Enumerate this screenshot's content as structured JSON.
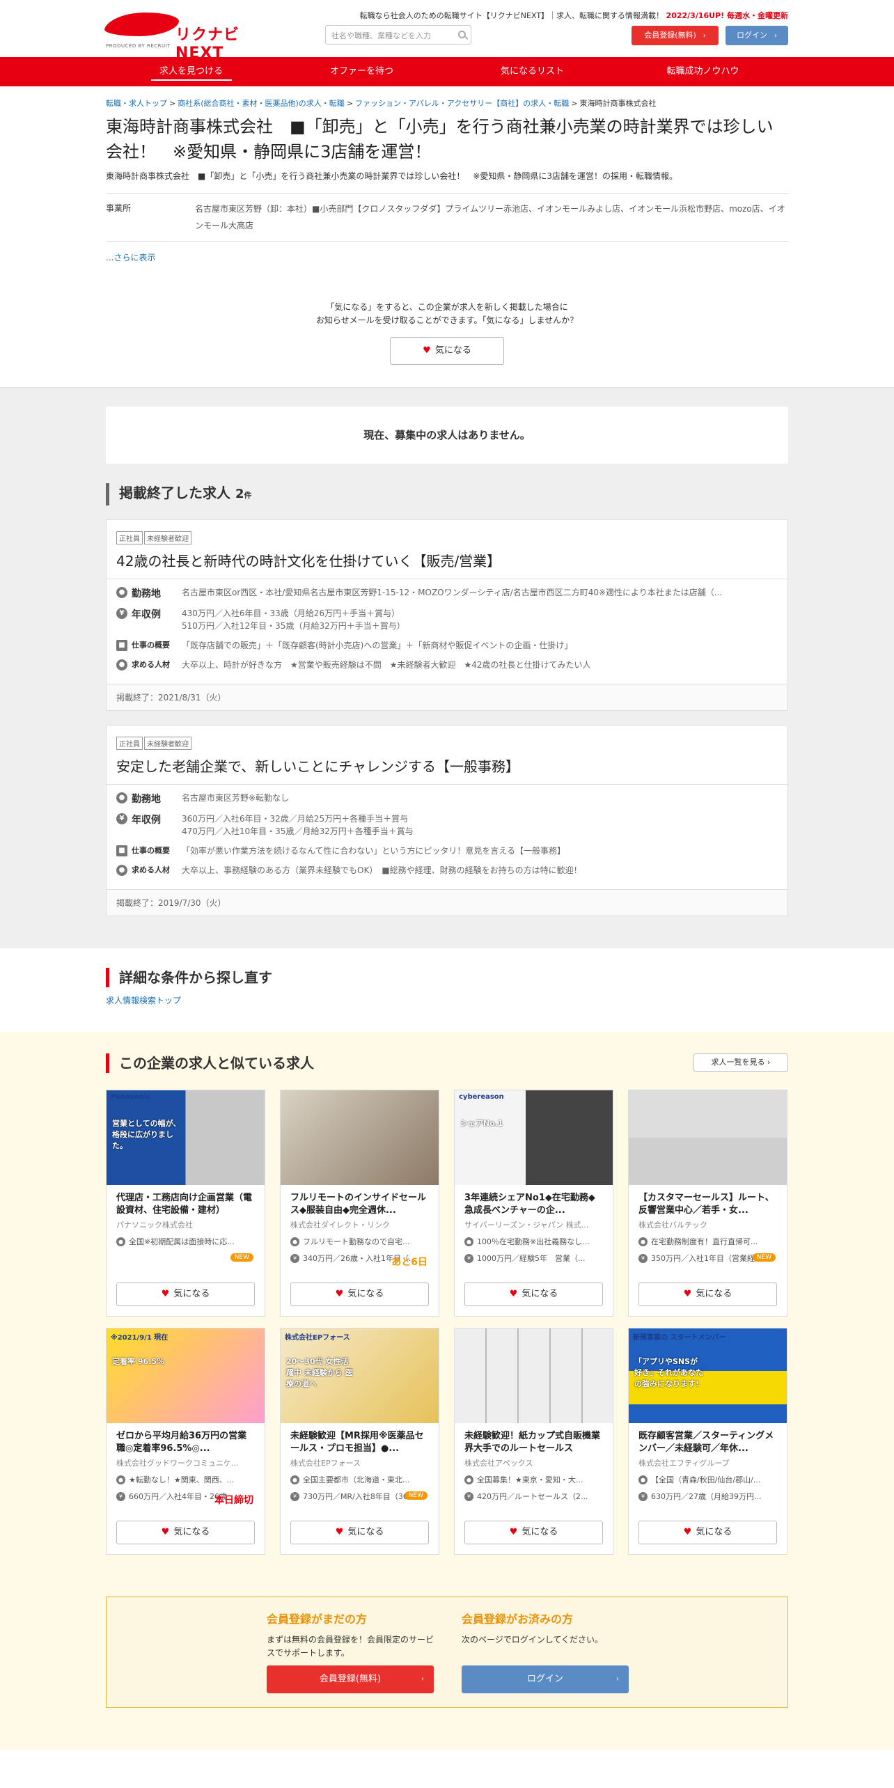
{
  "header": {
    "logo_text": "リクナビNEXT",
    "logo_sub": "PRODUCED BY RECRUIT",
    "tagline": "転職なら社会人のための転職サイト【リクナビNEXT】｜求人、転職に関する情報満載！",
    "update": "2022/3/16UP! 毎週水・金曜更新",
    "search_placeholder": "社名や職種、業種などを入力",
    "register_label": "会員登録(無料)",
    "login_label": "ログイン"
  },
  "nav": [
    "求人を見つける",
    "オファーを待つ",
    "気になるリスト",
    "転職成功ノウハウ"
  ],
  "breadcrumb": [
    "転職・求人トップ",
    "商社系(総合商社・素材・医薬品他)の求人・転職",
    "ファッション・アパレル・アクセサリー【商社】の求人・転職",
    "東海時計商事株式会社"
  ],
  "company": {
    "title": "東海時計商事株式会社　■「卸売」と「小売」を行う商社兼小売業の時計業界では珍しい会社！　※愛知県・静岡県に3店舗を運営！",
    "subtitle": "東海時計商事株式会社　■「卸売」と「小売」を行う商社兼小売業の時計業界では珍しい会社！　※愛知県・静岡県に3店舗を運営！の採用・転職情報。",
    "office_label": "事業所",
    "office_value": "名古屋市東区芳野（卸：本社）■小売部門【クロノスタッフダダ】プライムツリー赤池店、イオンモールみよし店、イオンモール浜松市野店、mozo店、イオンモール大高店",
    "more": "...さらに表示",
    "follow_text_1": "「気になる」をすると、この企業が求人を新しく掲載した場合に",
    "follow_text_2": "お知らせメールを受け取ることができます。「気になる」しませんか？",
    "follow_button": "気になる"
  },
  "no_jobs": "現在、募集中の求人はありません。",
  "ended": {
    "heading": "掲載終了した求人",
    "count": "2",
    "count_unit": "件",
    "jobs": [
      {
        "tags": [
          "正社員",
          "未経験者歓迎"
        ],
        "title": "42歳の社長と新時代の時計文化を仕掛けていく【販売/営業】",
        "loc_label": "勤務地",
        "loc": "名古屋市東区or西区・本社/愛知県名古屋市東区芳野1-15-12・MOZOワンダーシティ店/名古屋市西区二方町40※適性により本社または店舗（...",
        "sal_label": "年収例",
        "sal1": "430万円／入社6年目・33歳（月給26万円＋手当＋賞与）",
        "sal2": "510万円／入社12年目・35歳（月給32万円＋手当＋賞与）",
        "work_label": "仕事の概要",
        "work": "「既存店舗での販売」＋「既存顧客(時計小売店)への営業」＋「新商材や販促イベントの企画・仕掛け」",
        "req_label": "求める人材",
        "req": "大卒以上、時計が好きな方　★営業や販売経験は不問　★未経験者大歓迎　★42歳の社長と仕掛けてみたい人",
        "end": "掲載終了：2021/8/31（火）"
      },
      {
        "tags": [
          "正社員",
          "未経験者歓迎"
        ],
        "title": "安定した老舗企業で、新しいことにチャレンジする【一般事務】",
        "loc_label": "勤務地",
        "loc": "名古屋市東区芳野※転勤なし",
        "sal_label": "年収例",
        "sal1": "360万円／入社6年目・32歳／月給25万円＋各種手当＋賞与",
        "sal2": "470万円／入社10年目・35歳／月給32万円＋各種手当＋賞与",
        "work_label": "仕事の概要",
        "work": "「効率が悪い作業方法を続けるなんて性に合わない」という方にピッタリ！意見を言える【一般事務】",
        "req_label": "求める人材",
        "req": "大卒以上、事務経験のある方（業界未経験でもOK）　■総務や経理、財務の経験をお持ちの方は特に歓迎！",
        "end": "掲載終了：2019/7/30（火）"
      }
    ]
  },
  "detail": {
    "heading": "詳細な条件から探し直す",
    "link": "求人情報検索トップ"
  },
  "similar": {
    "heading": "この企業の求人と似ている求人",
    "list_button": "求人一覧を見る",
    "button_label": "気になる",
    "cards": [
      {
        "title": "代理店・工務店向け企画営業（電設資材、住宅設備・建材）",
        "company": "パナソニック株式会社",
        "loc": "全国※初期配属は面接時に応...",
        "sal": "",
        "badge": "NEW",
        "img_text": "営業としての幅が、格段に広がりました。",
        "img_brand": "Panasonic"
      },
      {
        "title": "フルリモートのインサイドセールス◆服装自由◆完全週休...",
        "company": "株式会社ダイレクト・リンク",
        "loc": "フルリモート勤務なので自宅...",
        "sal": "340万円／26歳・入社1年目（...",
        "badge": "あと6日",
        "img_text": "",
        "img_brand": ""
      },
      {
        "title": "3年連続シェアNo1◆在宅勤務◆急成長ベンチャーの企...",
        "company": "サイバーリーズン・ジャパン 株式...",
        "loc": "100％在宅勤務※出社義務なし...",
        "sal": "1000万円／経験5年　営業（...",
        "badge": "",
        "img_text": "シェアNo.1",
        "img_brand": "cybereason"
      },
      {
        "title": "【カスタマーセールス】ルート、反響営業中心／若手・女...",
        "company": "株式会社バルテック",
        "loc": "在宅勤務制度有！直行直帰可...",
        "sal": "350万円／入社1年目（営業経...",
        "badge": "NEW",
        "img_text": "",
        "img_brand": ""
      },
      {
        "title": "ゼロから平均月給36万円の営業職◎定着率96.5%◎...",
        "company": "株式会社グッドワークコミュニケ...",
        "loc": "★転勤なし！★関東、関西、...",
        "sal": "660万円／入社4年目・26歳　...",
        "badge": "本日締切",
        "img_text": "定着率 96.5%",
        "img_brand": "※2021/9/1 現在"
      },
      {
        "title": "未経験歓迎【MR採用※医薬品セールス・プロモ担当】●...",
        "company": "株式会社EPフォース",
        "loc": "全国主要都市（北海道・東北...",
        "sal": "730万円／MR/入社8年目（36...",
        "badge": "NEW",
        "img_text": "20〜30代 女性活躍中 未経験から 医療の道へ",
        "img_brand": "株式会社EPフォース"
      },
      {
        "title": "未経験歓迎！紙カップ式自販機業界大手でのルートセールス",
        "company": "株式会社アペックス",
        "loc": "全国募集！★東京・愛知・大...",
        "sal": "420万円／ルートセールス（2...",
        "badge": "",
        "img_text": "",
        "img_brand": ""
      },
      {
        "title": "既存顧客営業／スターティングメンバー／未経験可／年休...",
        "company": "株式会社エフティグループ",
        "loc": "【全国（青森/秋田/仙台/郡山/...",
        "sal": "630万円／27歳（月給39万円...",
        "badge": "",
        "img_text": "「アプリやSNSが好き」それがあなたの強みになります!",
        "img_brand": "新規事業の スタートメンバー"
      }
    ]
  },
  "member": {
    "left_heading": "会員登録がまだの方",
    "left_text": "まずは無料の会員登録を！会員限定のサービスでサポートします。",
    "left_button": "会員登録(無料)",
    "right_heading": "会員登録がお済みの方",
    "right_text": "次のページでログインしてください。",
    "right_button": "ログイン"
  },
  "colors": {
    "brand_red": "#e60012",
    "login_blue": "#5a8bc4",
    "accent_orange": "#e8940f"
  }
}
